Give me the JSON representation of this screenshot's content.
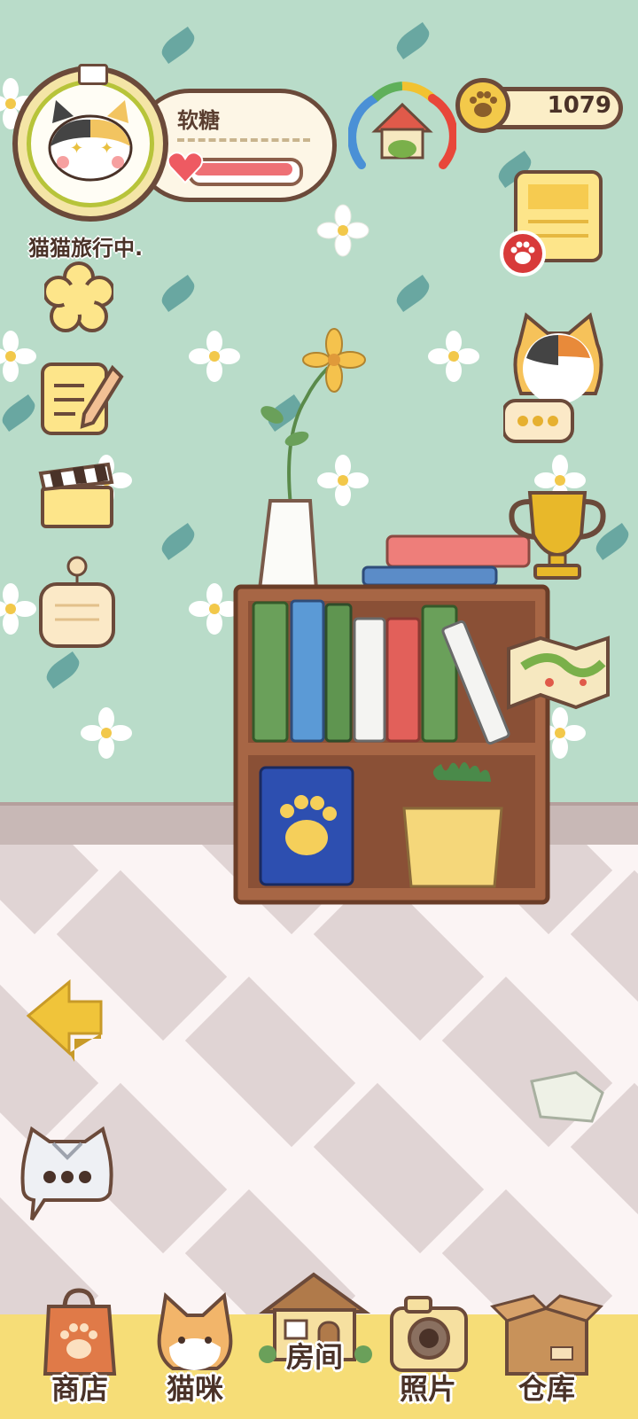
{
  "player": {
    "name": "软糖",
    "status": "猫猫旅行中."
  },
  "currency": {
    "coins": "1079",
    "icon": "paw-coin-icon"
  },
  "bottom_nav": {
    "items": [
      {
        "label": "商店",
        "icon": "shop-bag-icon"
      },
      {
        "label": "猫咪",
        "icon": "cat-face-icon"
      },
      {
        "label": "房间",
        "icon": "house-icon"
      },
      {
        "label": "照片",
        "icon": "camera-icon"
      },
      {
        "label": "仓库",
        "icon": "box-icon"
      }
    ]
  },
  "colors": {
    "wall": "#b9dcc9",
    "nav_bar": "#f6dd77",
    "outline": "#6b4a3a",
    "heart": "#ee7075"
  }
}
